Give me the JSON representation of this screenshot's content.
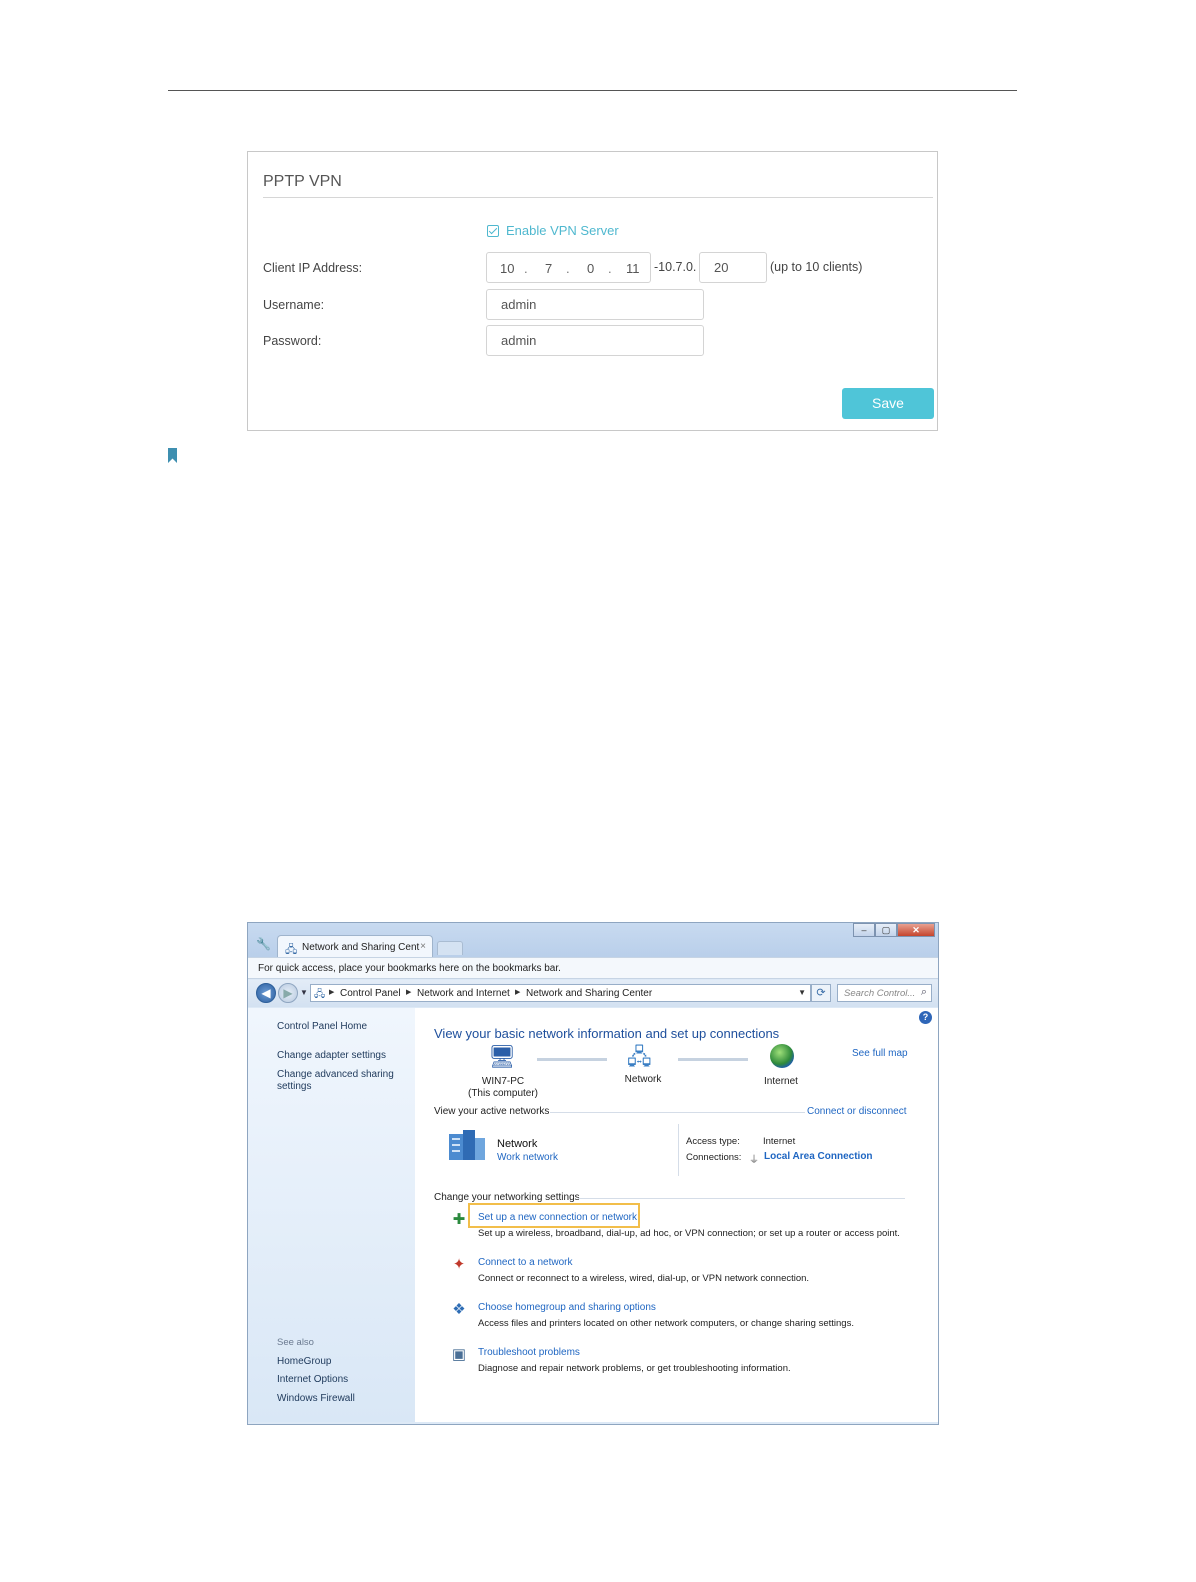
{
  "vpn": {
    "title": "PPTP VPN",
    "enable_label": "Enable VPN Server",
    "enable_checked": true,
    "client_ip_label": "Client IP Address:",
    "ip_octets": [
      "10",
      "7",
      "0",
      "11"
    ],
    "ip_range_prefix": "-10.7.0.",
    "ip_range_end": "20",
    "clients_note": "(up to 10 clients)",
    "username_label": "Username:",
    "username_value": "admin",
    "password_label": "Password:",
    "password_value": "admin",
    "save_label": "Save",
    "accent_color": "#4fc5d8"
  },
  "bookmark_icon": "bookmark-icon",
  "win": {
    "tab_title": "Network and Sharing Cent",
    "tab_close": "×",
    "bookmark_bar_text": "For quick access, place your bookmarks here on the bookmarks bar.",
    "breadcrumbs": [
      "Control Panel",
      "Network and Internet",
      "Network and Sharing Center"
    ],
    "search_placeholder": "Search Control...",
    "left_pane": {
      "links": [
        "Control Panel Home",
        "Change adapter settings",
        "Change advanced sharing settings"
      ],
      "see_also_label": "See also",
      "see_also": [
        "HomeGroup",
        "Internet Options",
        "Windows Firewall"
      ]
    },
    "heading": "View your basic network information and set up connections",
    "see_full_map": "See full map",
    "map": {
      "pc_name": "WIN7-PC",
      "pc_sub": "(This computer)",
      "network": "Network",
      "internet": "Internet"
    },
    "active_networks_label": "View your active networks",
    "connect_disconnect": "Connect or disconnect",
    "active_network": {
      "name": "Network",
      "type": "Work network",
      "access_type_label": "Access type:",
      "access_type_value": "Internet",
      "connections_label": "Connections:",
      "connections_value": "Local Area Connection"
    },
    "change_settings_label": "Change your networking settings",
    "tasks": [
      {
        "link": "Set up a new connection or network",
        "desc": "Set up a wireless, broadband, dial-up, ad hoc, or VPN connection; or set up a router or access point."
      },
      {
        "link": "Connect to a network",
        "desc": "Connect or reconnect to a wireless, wired, dial-up, or VPN network connection."
      },
      {
        "link": "Choose homegroup and sharing options",
        "desc": "Access files and printers located on other network computers, or change sharing settings."
      },
      {
        "link": "Troubleshoot problems",
        "desc": "Diagnose and repair network problems, or get troubleshooting information."
      }
    ],
    "highlight_color": "#f2be4a"
  }
}
